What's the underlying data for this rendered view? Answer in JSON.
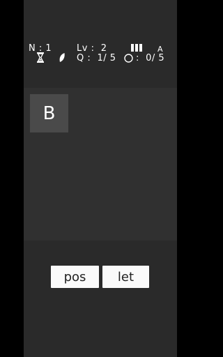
{
  "hud": {
    "n_label": "N : 1",
    "level_label": "Lv :  2",
    "question_label": "Q :  1/ 5",
    "score_label": ":  0/ 5",
    "answer_mode_letter": "A"
  },
  "icons": {
    "hourglass": "hourglass-icon",
    "leaf": "leaf-icon",
    "columns": "columns-icon",
    "circle": "circle-icon"
  },
  "board": {
    "tile_letter": "B"
  },
  "buttons": {
    "position_label": "pos",
    "letter_label": "let"
  },
  "colors": {
    "background": "#2a2a2a",
    "board": "#303030",
    "tile": "#4a4a4a",
    "button": "#fafafa"
  }
}
